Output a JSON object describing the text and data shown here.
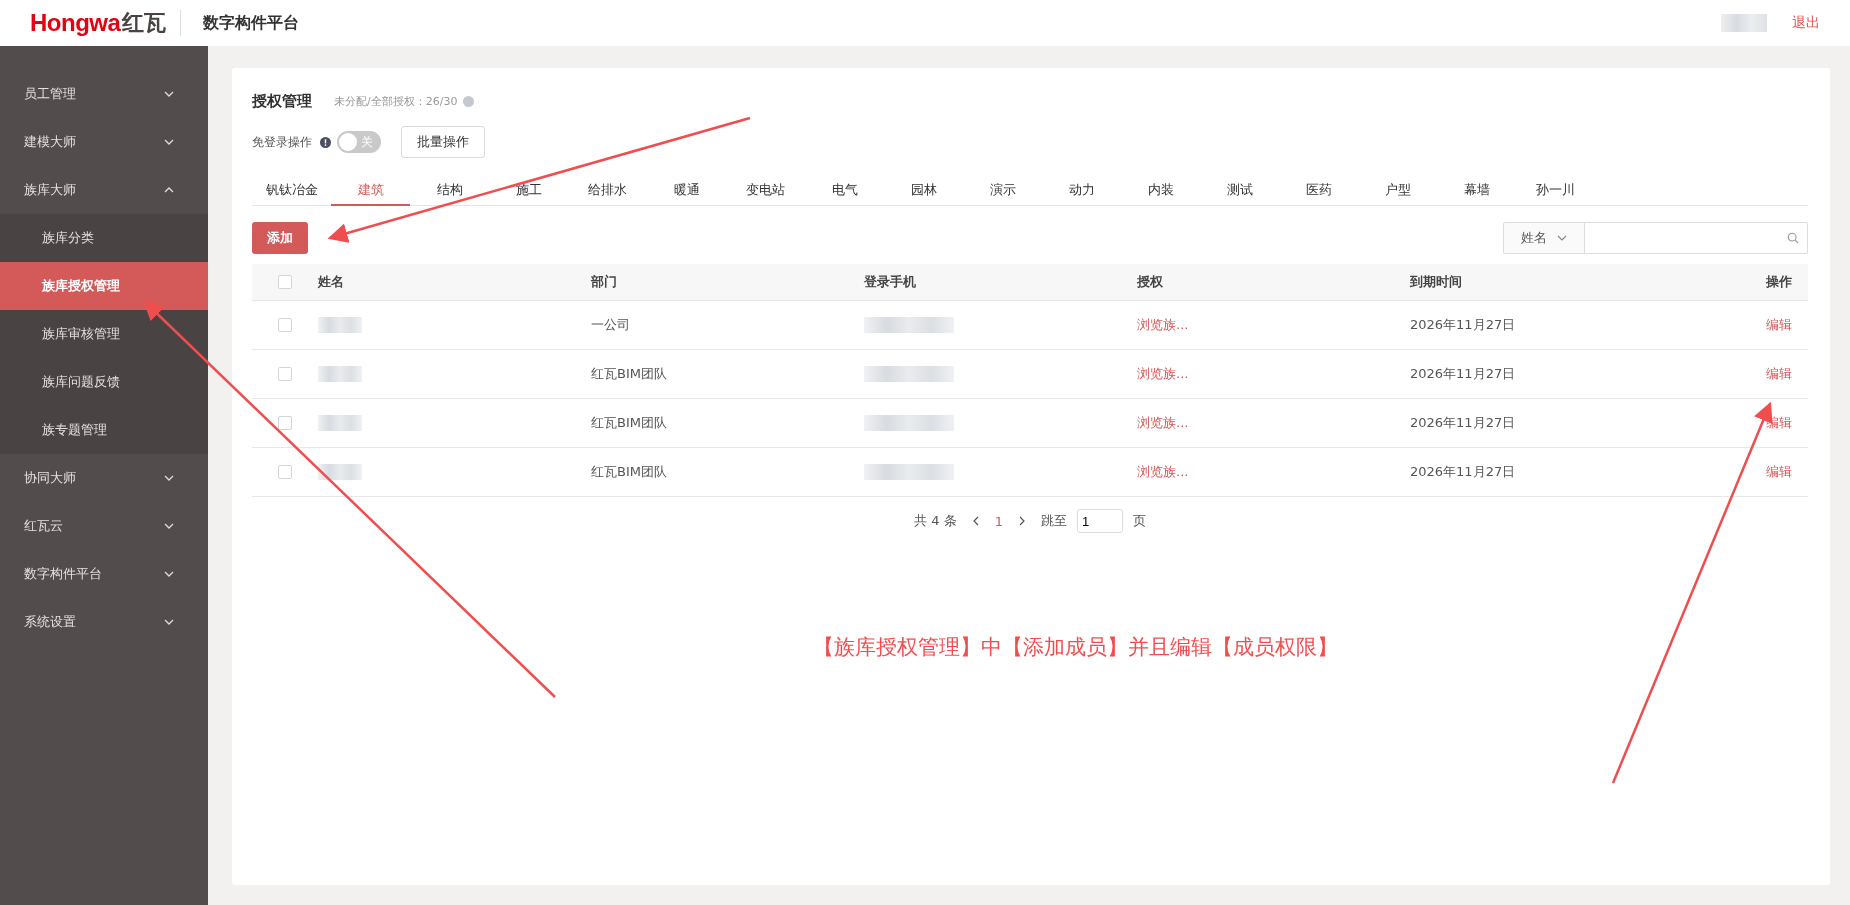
{
  "header": {
    "logo_latin": "Hongwa",
    "logo_cn": "红瓦",
    "platform": "数字构件平台",
    "logout": "退出"
  },
  "sidebar": {
    "items": [
      {
        "label": "员工管理",
        "expanded": false,
        "selected": false
      },
      {
        "label": "建模大师",
        "expanded": false,
        "selected": false
      },
      {
        "label": "族库大师",
        "expanded": true,
        "selected": false,
        "children": [
          {
            "label": "族库分类",
            "selected": false
          },
          {
            "label": "族库授权管理",
            "selected": true
          },
          {
            "label": "族库审核管理",
            "selected": false
          },
          {
            "label": "族库问题反馈",
            "selected": false
          },
          {
            "label": "族专题管理",
            "selected": false
          }
        ]
      },
      {
        "label": "协同大师",
        "expanded": false,
        "selected": false
      },
      {
        "label": "红瓦云",
        "expanded": false,
        "selected": false
      },
      {
        "label": "数字构件平台",
        "expanded": false,
        "selected": false
      },
      {
        "label": "系统设置",
        "expanded": false,
        "selected": false
      }
    ]
  },
  "page": {
    "title": "授权管理",
    "quota": "未分配/全部授权：26/30",
    "free_login": {
      "label": "免登录操作",
      "on": false,
      "toggle_text": "关"
    },
    "batch_button": "批量操作",
    "tabs": [
      {
        "label": "钒钛冶金",
        "selected": false
      },
      {
        "label": "建筑",
        "selected": true
      },
      {
        "label": "结构",
        "selected": false
      },
      {
        "label": "施工",
        "selected": false
      },
      {
        "label": "给排水",
        "selected": false
      },
      {
        "label": "暖通",
        "selected": false
      },
      {
        "label": "变电站",
        "selected": false
      },
      {
        "label": "电气",
        "selected": false
      },
      {
        "label": "园林",
        "selected": false
      },
      {
        "label": "演示",
        "selected": false
      },
      {
        "label": "动力",
        "selected": false
      },
      {
        "label": "内装",
        "selected": false
      },
      {
        "label": "测试",
        "selected": false
      },
      {
        "label": "医药",
        "selected": false
      },
      {
        "label": "户型",
        "selected": false
      },
      {
        "label": "幕墙",
        "selected": false
      },
      {
        "label": "孙一川",
        "selected": false
      }
    ],
    "add_button": "添加",
    "search": {
      "field": "姓名"
    },
    "table": {
      "select_all": {
        "checked": false
      },
      "columns": [
        "姓名",
        "部门",
        "登录手机",
        "授权",
        "到期时间",
        "操作"
      ],
      "rows": [
        {
          "checked": false,
          "department": "一公司",
          "authorization": "浏览族...",
          "expiry": "2026年11月27日",
          "action": "编辑"
        },
        {
          "checked": false,
          "department": "红瓦BIM团队",
          "authorization": "浏览族...",
          "expiry": "2026年11月27日",
          "action": "编辑"
        },
        {
          "checked": false,
          "department": "红瓦BIM团队",
          "authorization": "浏览族...",
          "expiry": "2026年11月27日",
          "action": "编辑"
        },
        {
          "checked": false,
          "department": "红瓦BIM团队",
          "authorization": "浏览族...",
          "expiry": "2026年11月27日",
          "action": "编辑"
        }
      ]
    },
    "pagination": {
      "total": "共 4 条",
      "pages": [
        {
          "label": "1",
          "selected": true
        }
      ],
      "jump_label": "跳至",
      "jump_value": "1",
      "suffix": "页"
    }
  },
  "annotation": {
    "text": "【族库授权管理】中【添加成员】并且编辑【成员权限】"
  }
}
